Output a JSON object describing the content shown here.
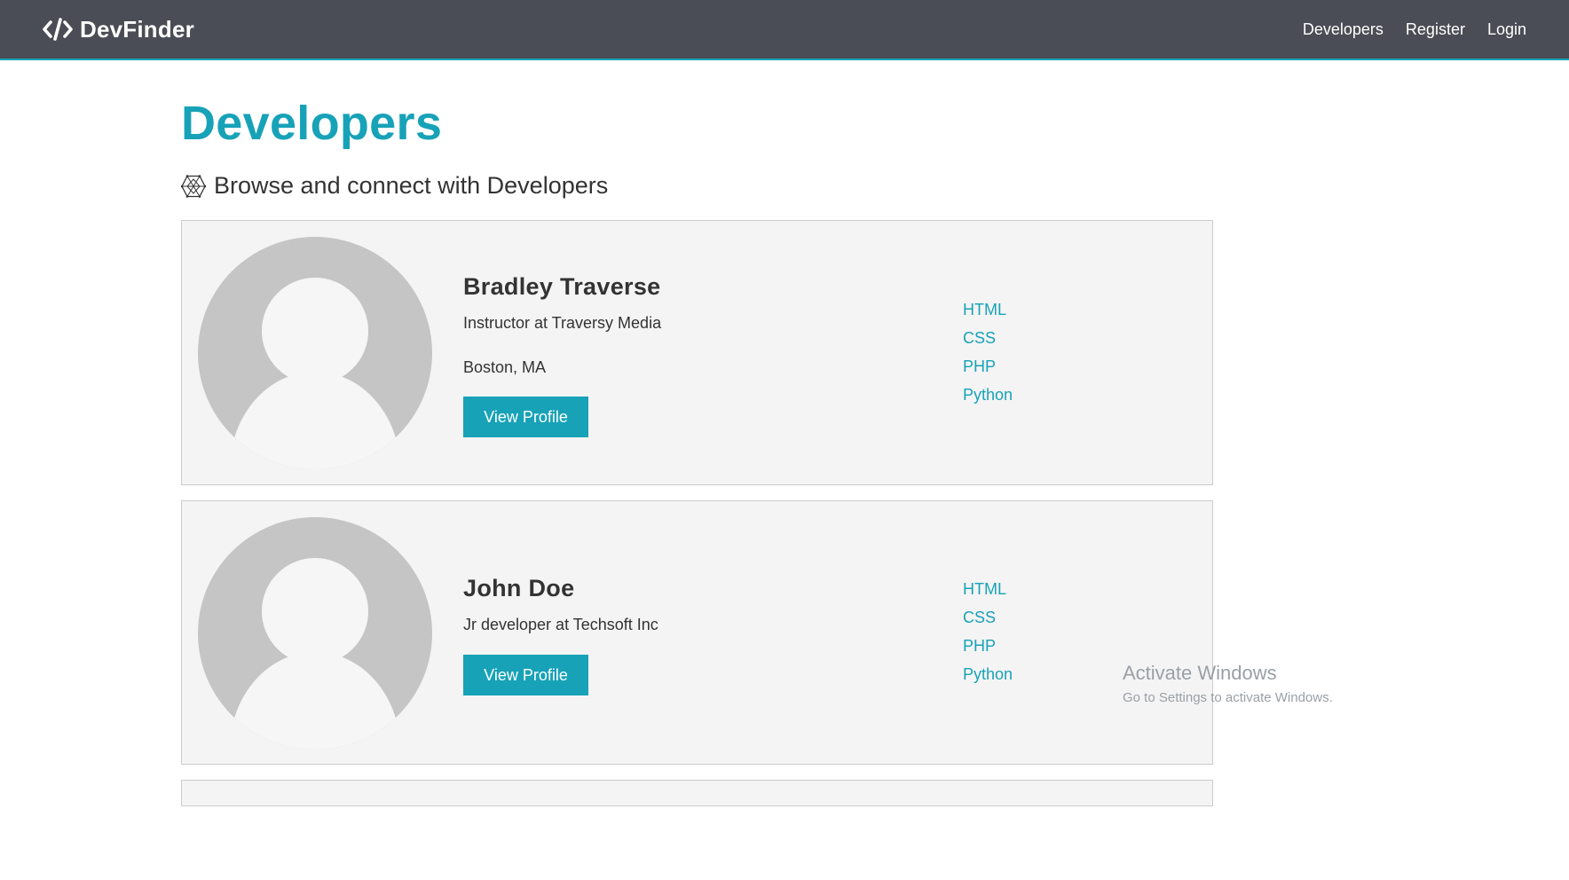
{
  "navbar": {
    "brand": "DevFinder",
    "brand_icon": "code-icon",
    "links": [
      "Developers",
      "Register",
      "Login"
    ]
  },
  "page": {
    "title": "Developers",
    "lead": "Browse and connect with Developers",
    "lead_icon": "connectdevelop-icon"
  },
  "profiles": [
    {
      "name": "Bradley Traverse",
      "status": "Instructor at Traversy Media",
      "location": "Boston, MA",
      "button": "View Profile",
      "skills": [
        "HTML",
        "CSS",
        "PHP",
        "Python"
      ]
    },
    {
      "name": "John Doe",
      "status": "Jr developer at Techsoft Inc",
      "button": "View Profile",
      "skills": [
        "HTML",
        "CSS",
        "PHP",
        "Python"
      ]
    }
  ],
  "watermark": {
    "title": "Activate Windows",
    "subtitle": "Go to Settings to activate Windows."
  },
  "colors": {
    "accent": "#17a2b8",
    "navbar": "#4a4d55",
    "card_bg": "#f4f4f4"
  }
}
